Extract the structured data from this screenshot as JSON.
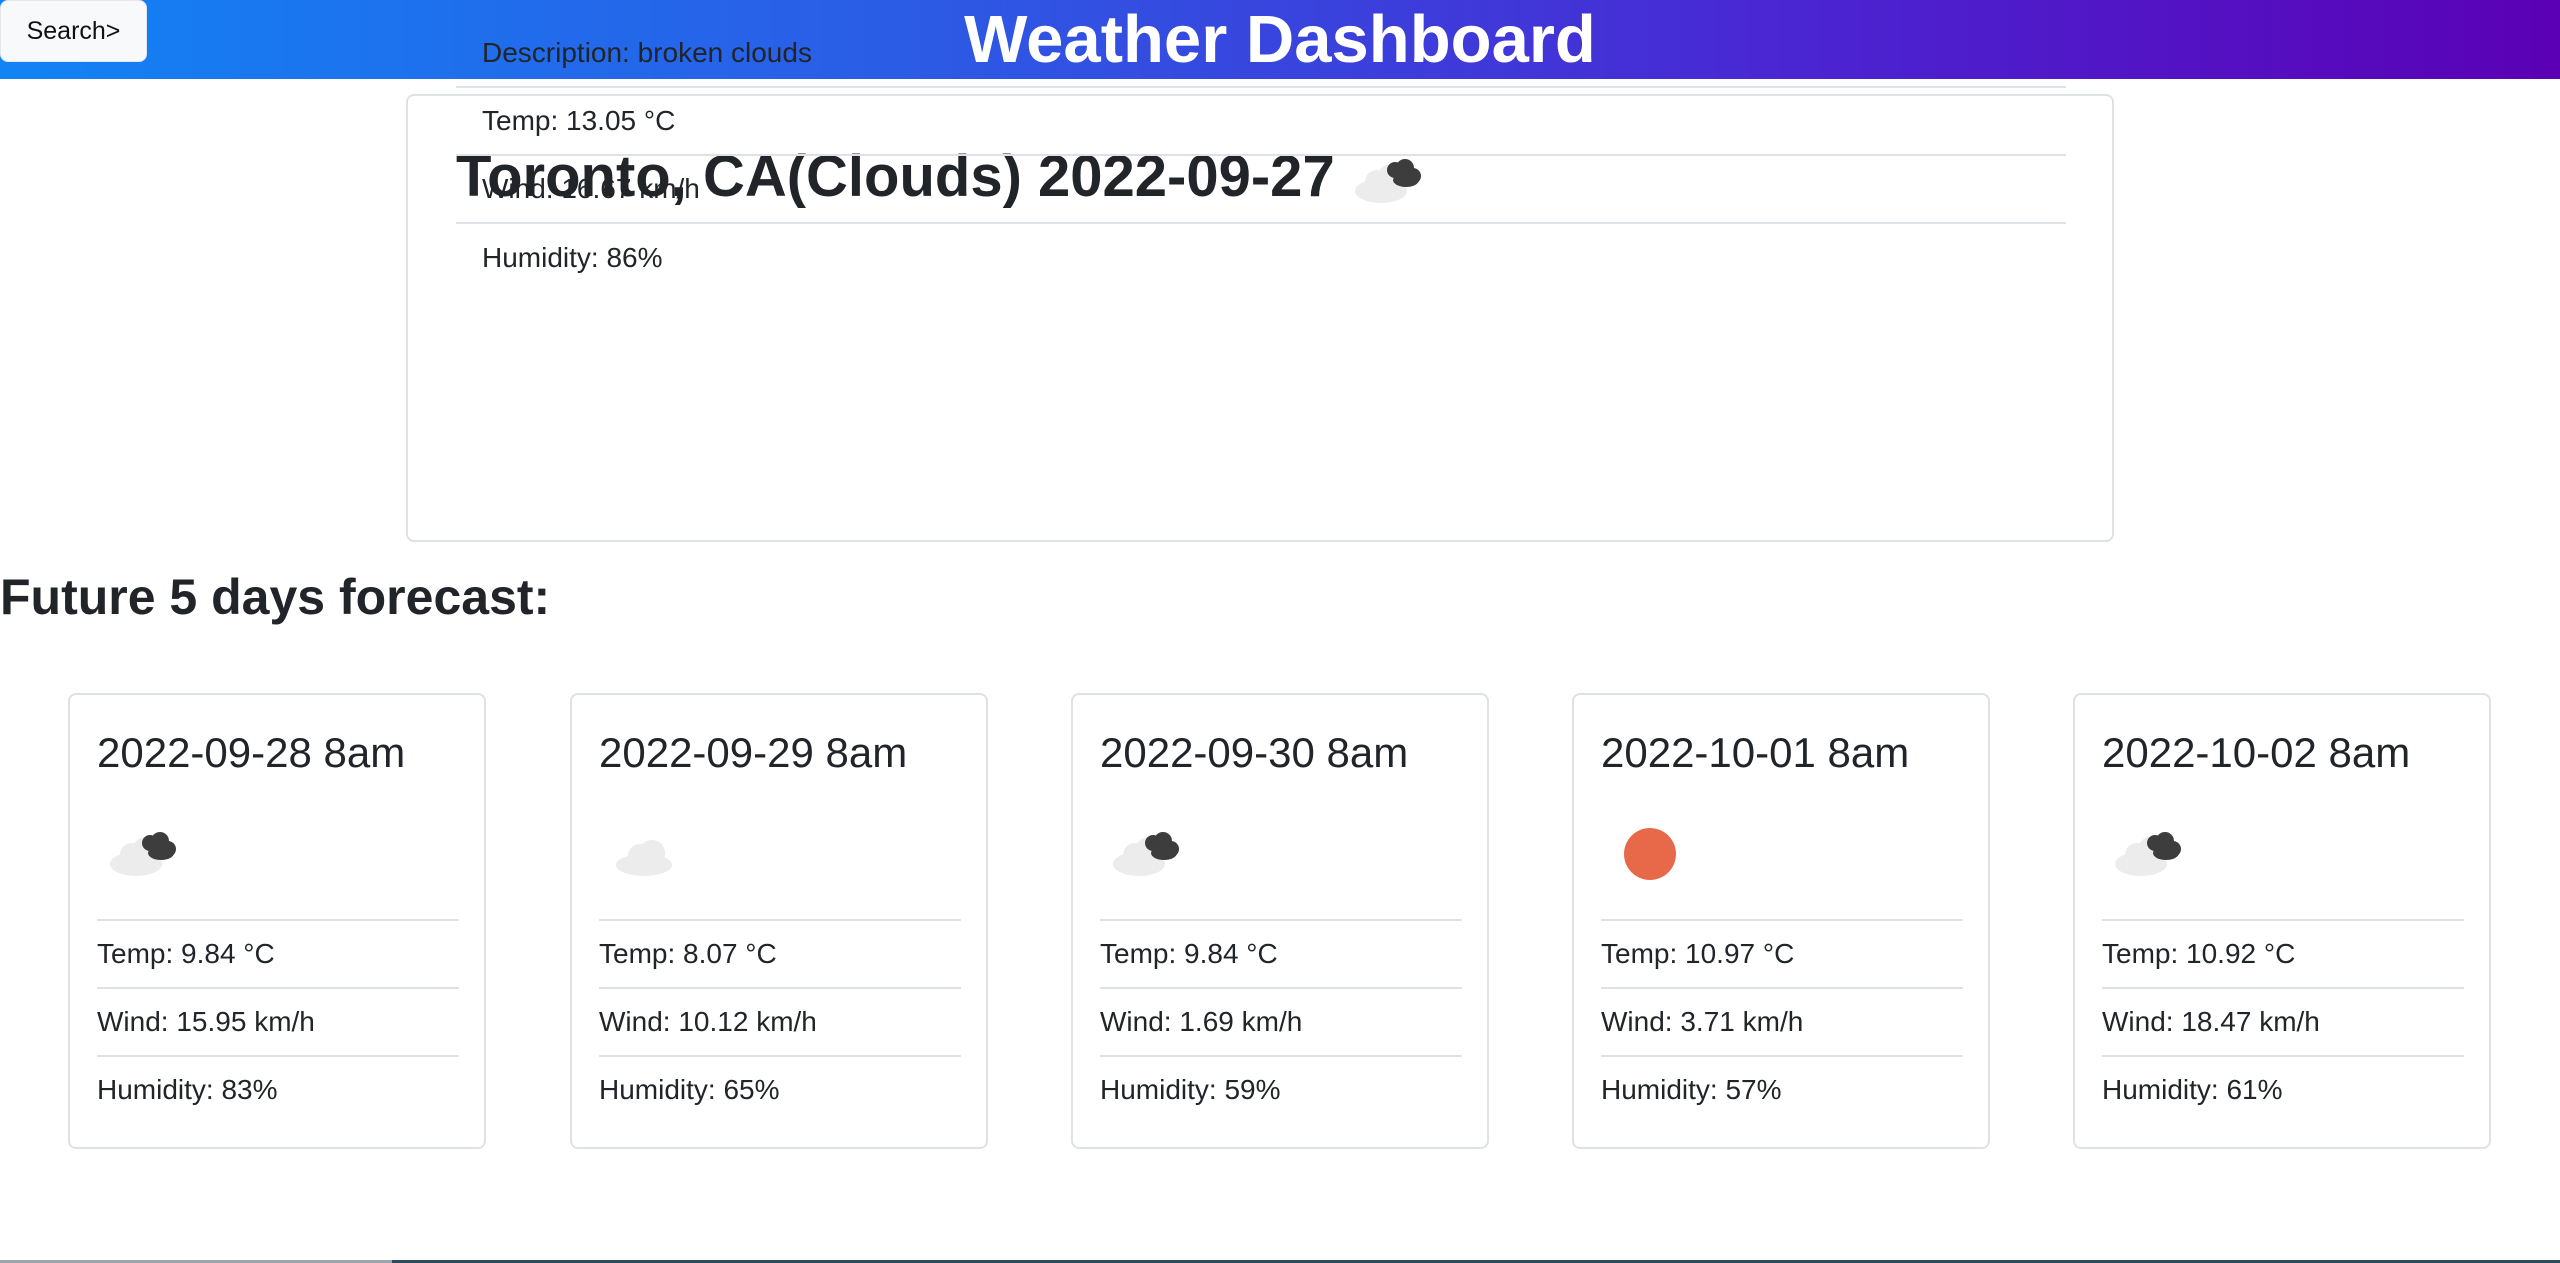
{
  "header": {
    "search_label": "Search>",
    "title": "Weather Dashboard"
  },
  "current": {
    "heading": "Toronto, CA(Clouds) 2022-09-27",
    "icon": "broken-clouds-icon",
    "description": "Description: broken clouds",
    "temp": "Temp: 13.05 °C",
    "wind": "Wind: 16.67 km/h",
    "humidity": "Humidity: 86%"
  },
  "forecast_title": "Future 5 days forecast:",
  "forecast": [
    {
      "date": "2022-09-28 8am",
      "icon": "broken-clouds-icon",
      "temp": "Temp: 9.84 °C",
      "wind": "Wind: 15.95 km/h",
      "humidity": "Humidity: 83%"
    },
    {
      "date": "2022-09-29 8am",
      "icon": "few-clouds-icon",
      "temp": "Temp: 8.07 °C",
      "wind": "Wind: 10.12 km/h",
      "humidity": "Humidity: 65%"
    },
    {
      "date": "2022-09-30 8am",
      "icon": "broken-clouds-icon",
      "temp": "Temp: 9.84 °C",
      "wind": "Wind: 1.69 km/h",
      "humidity": "Humidity: 59%"
    },
    {
      "date": "2022-10-01 8am",
      "icon": "clear-sky-icon",
      "temp": "Temp: 10.97 °C",
      "wind": "Wind: 3.71 km/h",
      "humidity": "Humidity: 57%"
    },
    {
      "date": "2022-10-02 8am",
      "icon": "broken-clouds-icon",
      "temp": "Temp: 10.92 °C",
      "wind": "Wind: 18.47 km/h",
      "humidity": "Humidity: 61%"
    }
  ],
  "colors": {
    "header_start": "#1283f4",
    "header_end": "#5b00b5",
    "sun": "#e8694a"
  }
}
